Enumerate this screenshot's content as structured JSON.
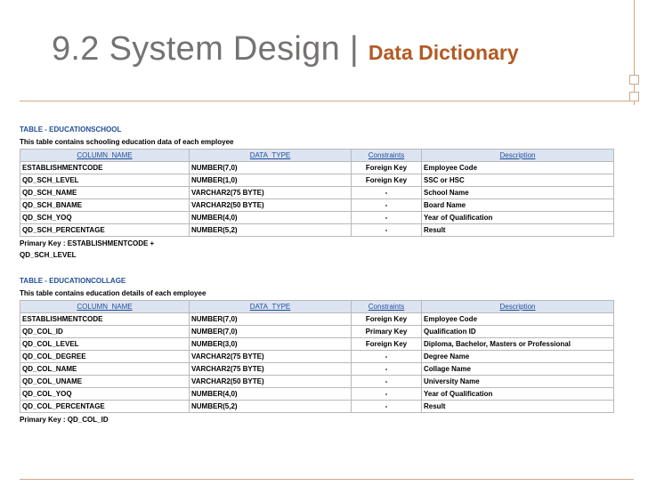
{
  "slide": {
    "title_main": "9.2  System Design | ",
    "title_sub": "Data Dictionary"
  },
  "colors": {
    "title": "#757371",
    "subtitle": "#b25a23",
    "accent_line": "#cfa98a",
    "table_title": "#1f4e9a",
    "header_bg": "#dce4f2"
  },
  "tables": [
    {
      "title": "TABLE - EDUCATIONSCHOOL",
      "description": "This table contains schooling education data of each employee",
      "headers": [
        "COLUMN_NAME",
        "DATA_TYPE",
        "Constraints",
        "Description"
      ],
      "rows": [
        [
          "ESTABLISHMENTCODE",
          "NUMBER(7,0)",
          "Foreign Key",
          "Employee Code"
        ],
        [
          "QD_SCH_LEVEL",
          "NUMBER(1,0)",
          "Foreign Key",
          "SSC or HSC"
        ],
        [
          "QD_SCH_NAME",
          "VARCHAR2(75 BYTE)",
          "-",
          "School Name"
        ],
        [
          "QD_SCH_BNAME",
          "VARCHAR2(50 BYTE)",
          "-",
          "Board Name"
        ],
        [
          "QD_SCH_YOQ",
          "NUMBER(4,0)",
          "-",
          "Year of Qualification"
        ],
        [
          "QD_SCH_PERCENTAGE",
          "NUMBER(5,2)",
          "-",
          "Result"
        ]
      ],
      "primary_key": "Primary Key : ESTABLISHMENTCODE  + QD_SCH_LEVEL"
    },
    {
      "title": "TABLE - EDUCATIONCOLLAGE",
      "description": "This table contains education details of each employee",
      "headers": [
        "COLUMN_NAME",
        "DATA_TYPE",
        "Constraints",
        "Description"
      ],
      "rows": [
        [
          "ESTABLISHMENTCODE",
          "NUMBER(7,0)",
          "Foreign Key",
          "Employee Code"
        ],
        [
          "QD_COL_ID",
          "NUMBER(7,0)",
          "Primary Key",
          "Qualification ID"
        ],
        [
          "QD_COL_LEVEL",
          "NUMBER(3,0)",
          "Foreign Key",
          "Diploma, Bachelor, Masters or Professional"
        ],
        [
          "QD_COL_DEGREE",
          "VARCHAR2(75 BYTE)",
          "-",
          "Degree Name"
        ],
        [
          "QD_COL_NAME",
          "VARCHAR2(75 BYTE)",
          "-",
          "Collage Name"
        ],
        [
          "QD_COL_UNAME",
          "VARCHAR2(50 BYTE)",
          "-",
          "University Name"
        ],
        [
          "QD_COL_YOQ",
          "NUMBER(4,0)",
          "-",
          "Year of Qualification"
        ],
        [
          "QD_COL_PERCENTAGE",
          "NUMBER(5,2)",
          "-",
          "Result"
        ]
      ],
      "primary_key": "Primary Key : QD_COL_ID"
    }
  ]
}
